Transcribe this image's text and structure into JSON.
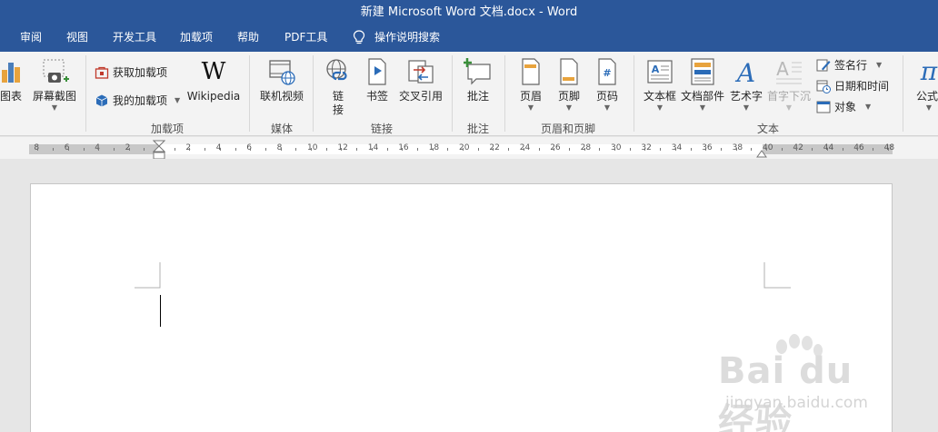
{
  "window": {
    "title": "新建 Microsoft Word 文档.docx  -  Word"
  },
  "tabs": [
    "审阅",
    "视图",
    "开发工具",
    "加载项",
    "帮助",
    "PDF工具"
  ],
  "tell_me": "操作说明搜索",
  "ribbon": {
    "groups": {
      "illustrations": {
        "chart": "图表",
        "screenshot": "屏幕截图"
      },
      "addins": {
        "label": "加载项",
        "get": "获取加载项",
        "my": "我的加载项",
        "wikipedia": "Wikipedia",
        "wiki_glyph": "W"
      },
      "media": {
        "label": "媒体",
        "online_video": "联机视频"
      },
      "links": {
        "label": "链接",
        "link_1": "链",
        "link_2": "接",
        "bookmark": "书签",
        "crossref": "交叉引用"
      },
      "comments": {
        "label": "批注",
        "comment": "批注"
      },
      "header_footer": {
        "label": "页眉和页脚",
        "header": "页眉",
        "footer": "页脚",
        "page_number": "页码"
      },
      "text": {
        "label": "文本",
        "textbox": "文本框",
        "quickparts": "文档部件",
        "wordart": "艺术字",
        "dropcap": "首字下沉",
        "signature": "签名行",
        "datetime": "日期和时间",
        "object": "对象"
      },
      "symbols": {
        "equation": "公式"
      }
    }
  },
  "ruler": {
    "numbers": [
      "8",
      "6",
      "4",
      "2",
      "2",
      "4",
      "6",
      "8",
      "10",
      "12",
      "14",
      "16",
      "18",
      "20",
      "22",
      "24",
      "26",
      "28",
      "30",
      "32",
      "34",
      "36",
      "38",
      "40",
      "42",
      "44",
      "46",
      "48"
    ]
  },
  "watermark": {
    "brand": "Bai du 经验",
    "url": "jingyan.baidu.com"
  },
  "colors": {
    "title_bar": "#2b579a",
    "ribbon": "#f3f3f3",
    "doc_bg": "#e6e6e6"
  }
}
